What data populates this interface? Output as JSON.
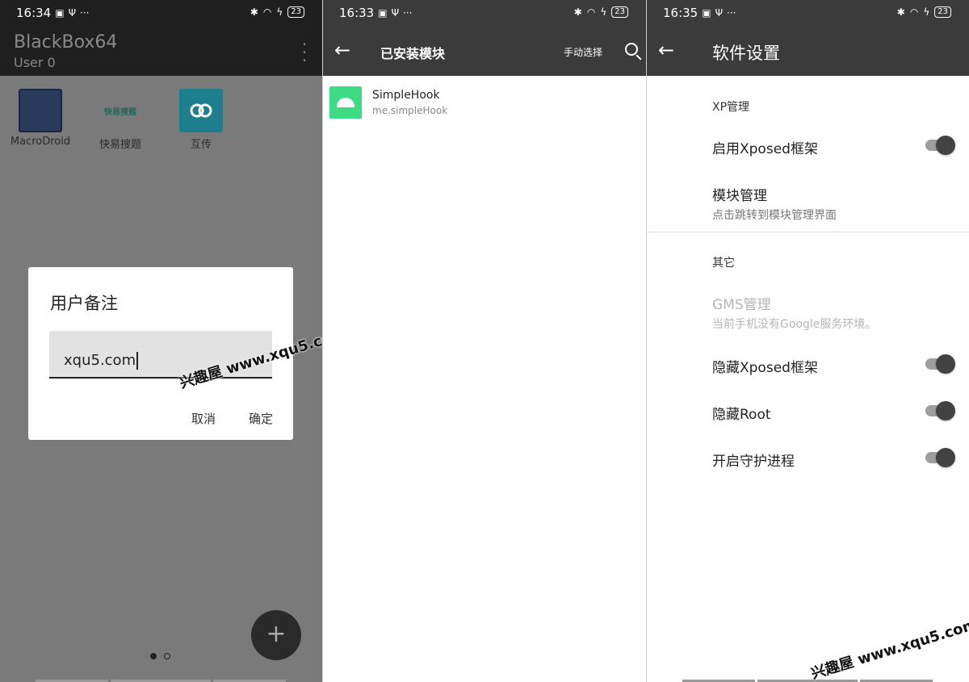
{
  "panel1": {
    "status": {
      "time": "16:34",
      "battery": "23"
    },
    "app_title": "BlackBox64",
    "app_subtitle": "User 0",
    "apps": [
      {
        "label": "MacroDroid"
      },
      {
        "label": "快易搜题",
        "icon_text": "快易搜题"
      },
      {
        "label": "互传"
      }
    ],
    "dialog": {
      "title": "用户备注",
      "input_value": "xqu5.com",
      "cancel_label": "取消",
      "ok_label": "确定"
    },
    "fab_label": "+"
  },
  "panel2": {
    "status": {
      "time": "16:33",
      "battery": "23"
    },
    "title": "已安装模块",
    "manual_select_label": "手动选择",
    "modules": [
      {
        "name": "SimpleHook",
        "package": "me.simpleHook"
      }
    ]
  },
  "panel3": {
    "status": {
      "time": "16:35",
      "battery": "23"
    },
    "title": "软件设置",
    "section_xp": "XP管理",
    "enable_xposed": "启用Xposed框架",
    "module_mgmt": {
      "label": "模块管理",
      "sub": "点击跳转到模块管理界面"
    },
    "section_other": "其它",
    "gms": {
      "label": "GMS管理",
      "sub": "当前手机没有Google服务环境。"
    },
    "hide_xposed": "隐藏Xposed框架",
    "hide_root": "隐藏Root",
    "daemon": "开启守护进程",
    "switches": {
      "enable_xposed": true,
      "hide_xposed": true,
      "hide_root": true,
      "daemon": true
    }
  },
  "watermark": "兴趣屋 www.xqu5.com",
  "colors": {
    "toolbar": "#3b3b3b",
    "scrim": "#7a7a7a",
    "android_green": "#3ddc84"
  }
}
